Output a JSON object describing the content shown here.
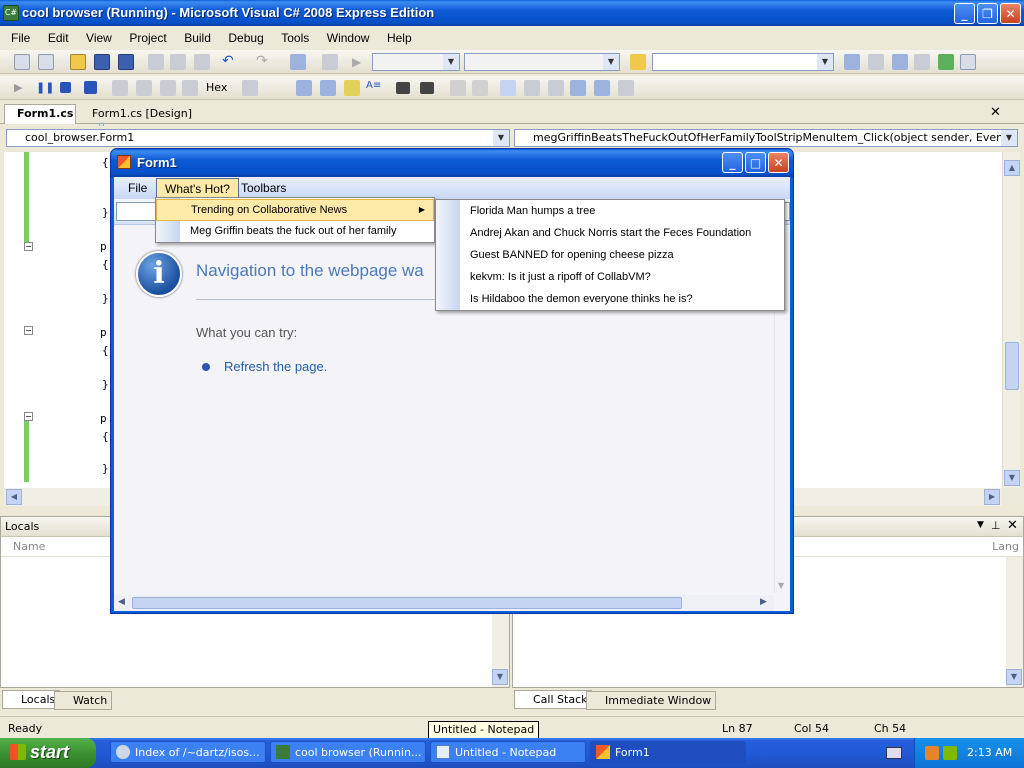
{
  "ide": {
    "title": "cool browser (Running) - Microsoft Visual C# 2008 Express Edition",
    "menu": [
      "File",
      "Edit",
      "View",
      "Project",
      "Build",
      "Debug",
      "Tools",
      "Window",
      "Help"
    ],
    "toolbar2_hex_label": "Hex",
    "tabs": [
      "Form1.cs",
      "Form1.cs [Design]"
    ],
    "class_combo": "cool_browser.Form1",
    "member_combo": "megGriffinBeatsTheFuckOutOfHerFamilyToolStripMenuItem_Click(object sender, EventArgs e)",
    "code_fragments": [
      "{",
      "}",
      "p",
      "{",
      "}",
      "p",
      "{",
      "}",
      "p",
      "{",
      "}"
    ],
    "locals_panel": {
      "title": "Locals",
      "column_name": "Name"
    },
    "callstack_panel": {
      "column_lang": "Lang"
    },
    "bottom_tabs_left": [
      "Locals",
      "Watch"
    ],
    "bottom_tabs_right": [
      "Call Stack",
      "Immediate Window"
    ],
    "status": {
      "ready": "Ready",
      "ln": "Ln 87",
      "col": "Col 54",
      "ch": "Ch 54"
    },
    "tooltip": "Untitled - Notepad"
  },
  "form": {
    "title": "Form1",
    "menu": [
      "File",
      "What's Hot?",
      "Toolbars"
    ],
    "error": {
      "heading": "Navigation to the webpage wa",
      "try_label": "What you can try:",
      "refresh_link": "Refresh the page."
    }
  },
  "whats_hot_menu": {
    "items": [
      "Trending on Collaborative News",
      "Meg Griffin beats the fuck out of her family"
    ]
  },
  "news_submenu": {
    "items": [
      "Florida Man humps a tree",
      "Andrej Akan and Chuck Norris start the Feces Foundation",
      "Guest BANNED for opening cheese pizza",
      "kekvm: Is it just a ripoff of CollabVM?",
      "Is Hildaboo the demon everyone thinks he is?"
    ]
  },
  "taskbar": {
    "start_label": "start",
    "tasks": [
      "Index of /~dartz/isos...",
      "cool browser (Runnin...",
      "Untitled - Notepad",
      "Form1"
    ],
    "clock": "2:13 AM"
  },
  "colors": {
    "xp_blue": "#0a5fd8",
    "menu_highlight": "#fde9a8",
    "error_link": "#1f5fa8"
  }
}
